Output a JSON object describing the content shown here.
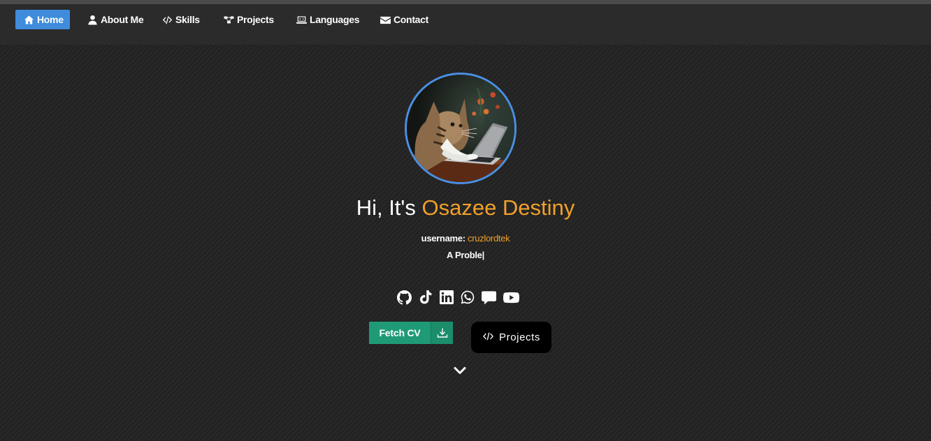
{
  "nav": {
    "items": [
      {
        "label": "Home",
        "icon": "home-icon",
        "active": true
      },
      {
        "label": "About Me",
        "icon": "user-icon"
      },
      {
        "label": "Skills",
        "icon": "code-icon"
      },
      {
        "label": "Projects",
        "icon": "sitemap-icon"
      },
      {
        "label": "Languages",
        "icon": "laptop-code-icon"
      },
      {
        "label": "Contact",
        "icon": "envelope-icon"
      }
    ]
  },
  "hero": {
    "greeting_prefix": "Hi, It's",
    "name": "Osazee Destiny",
    "username_label": "username:",
    "username_value": "cruzlordtek",
    "typing_text": "A Proble|",
    "avatar_alt": "cat typing on a laptop"
  },
  "socials": [
    "github-icon",
    "tiktok-icon",
    "linkedin-icon",
    "whatsapp-icon",
    "comment-icon",
    "youtube-icon"
  ],
  "actions": {
    "cv_label": "Fetch CV",
    "projects_label": "Projects"
  },
  "colors": {
    "accent": "#f0a02a",
    "nav_active": "#3f8cdc",
    "cv_button": "#1f9a76",
    "avatar_border": "#4a90e2"
  }
}
